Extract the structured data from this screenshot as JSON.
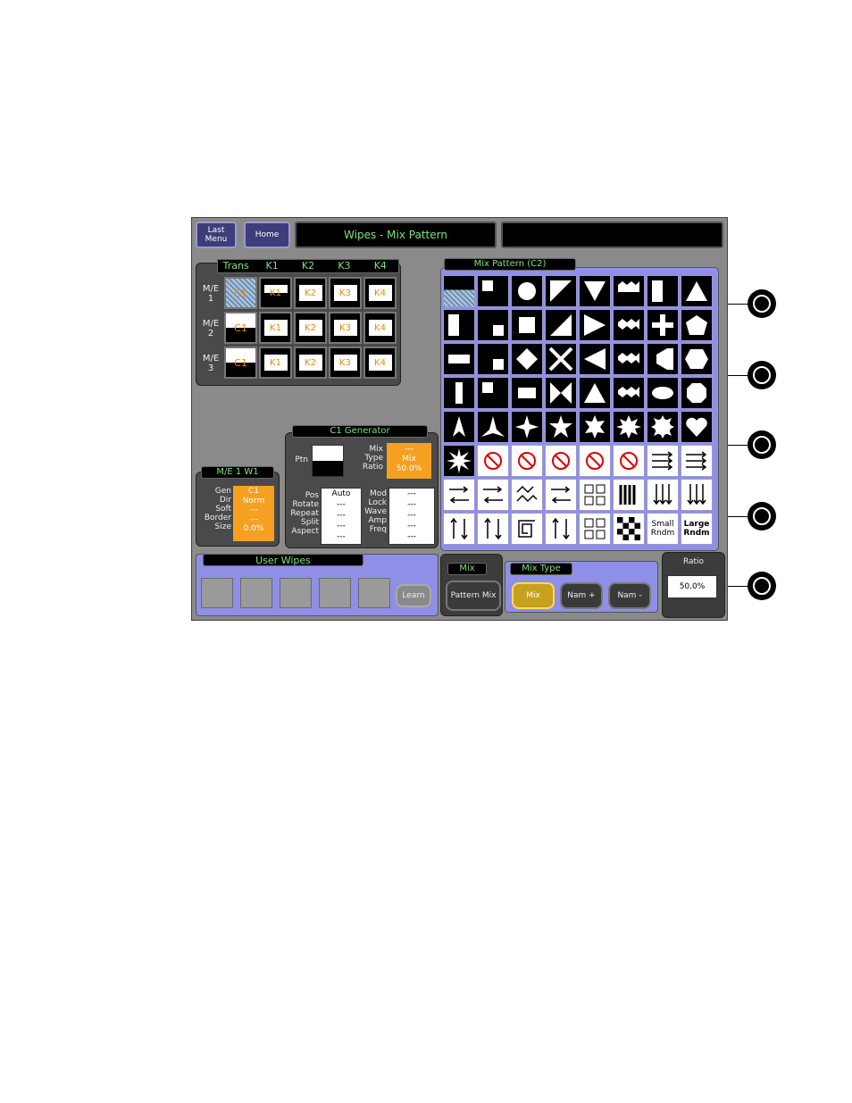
{
  "nav": {
    "last_menu": "Last Menu",
    "home": "Home",
    "title": "Wipes - Mix Pattern",
    "title2": ""
  },
  "trans_table": {
    "headers": [
      "Trans",
      "K1",
      "K2",
      "K3",
      "K4"
    ],
    "rows": [
      {
        "label": "M/E 1",
        "cells": [
          "C1",
          "K1",
          "K2",
          "K3",
          "K4"
        ]
      },
      {
        "label": "M/E 2",
        "cells": [
          "C1",
          "K1",
          "K2",
          "K3",
          "K4"
        ]
      },
      {
        "label": "M/E 3",
        "cells": [
          "C1",
          "K1",
          "K2",
          "K3",
          "K4"
        ]
      }
    ]
  },
  "me1w1": {
    "title": "M/E 1 W1",
    "labels": [
      "Gen",
      "Dir",
      "Soft",
      "Border",
      "Size"
    ],
    "values": [
      "C1",
      "Norm",
      "---",
      "---",
      "0.0%"
    ]
  },
  "c1gen": {
    "title": "C1 Generator",
    "ptn_label": "Ptn",
    "mix_labels": [
      "Mix",
      "Type",
      "Ratio"
    ],
    "mix_values": [
      "---",
      "Mix",
      "50.0%"
    ],
    "pos_labels": [
      "Pos",
      "Rotate",
      "Repeat",
      "Split",
      "Aspect"
    ],
    "pos_values": [
      "Auto",
      "---",
      "---",
      "---",
      "---"
    ],
    "mod_labels": [
      "Mod",
      "Lock",
      "Wave",
      "Amp",
      "Freq"
    ],
    "mod_values": [
      "---",
      "---",
      "---",
      "---",
      "---"
    ]
  },
  "mix_pattern": {
    "title": "Mix Pattern (C2)",
    "small_rndm": "Small Rndm",
    "large_rndm": "Large Rndm"
  },
  "user_wipes": {
    "title": "User Wipes",
    "learn": "Learn"
  },
  "mix": {
    "title": "Mix",
    "button": "Pattern Mix"
  },
  "mix_type": {
    "title": "Mix Type",
    "buttons": [
      "Mix",
      "Nam +",
      "Nam -"
    ]
  },
  "ratio": {
    "title": "Ratio",
    "value": "50.0%"
  },
  "colors": {
    "accent_orange": "#f5a020",
    "text_green": "#7fe07f",
    "pattern_panel": "#8f8fe8"
  }
}
